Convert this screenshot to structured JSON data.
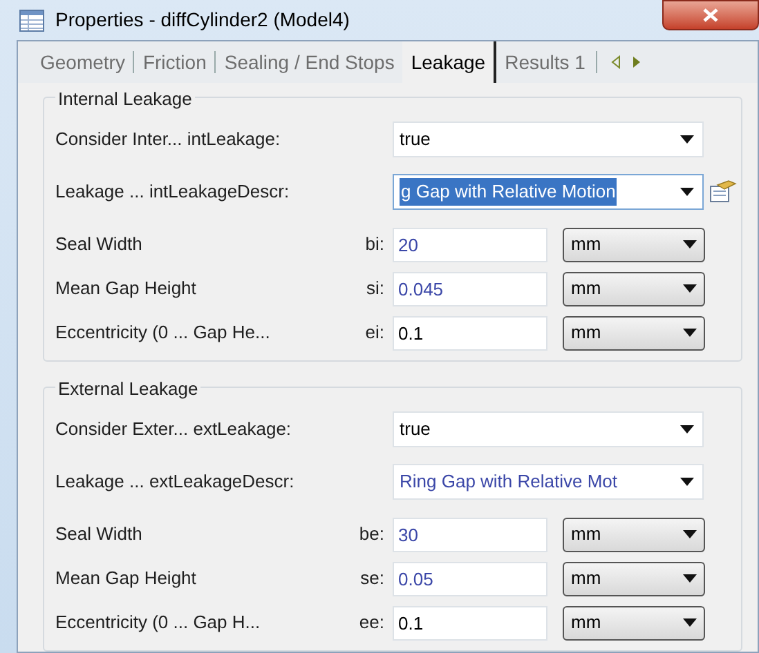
{
  "window": {
    "title": "Properties - diffCylinder2 (Model4)"
  },
  "tabs": [
    {
      "label": "Geometry",
      "selected": false
    },
    {
      "label": "Friction",
      "selected": false
    },
    {
      "label": "Sealing / End Stops",
      "selected": false
    },
    {
      "label": "Leakage",
      "selected": true
    },
    {
      "label": "Results 1",
      "selected": false
    }
  ],
  "groups": [
    {
      "title": "Internal Leakage",
      "rows": [
        {
          "kind": "dropdown",
          "label": "Consider Inter... intLeakage:",
          "value": "true",
          "modified": false,
          "text_selected": false,
          "editor_button": false
        },
        {
          "kind": "dropdown",
          "label": "Leakage ... intLeakageDescr:",
          "value": "g Gap with Relative Motion",
          "modified": false,
          "text_selected": true,
          "editor_button": true
        },
        {
          "kind": "quantity",
          "label": "Seal Width",
          "symbol": "bi:",
          "value": "20",
          "modified": true,
          "unit": "mm"
        },
        {
          "kind": "quantity",
          "label": "Mean Gap Height",
          "symbol": "si:",
          "value": "0.045",
          "modified": true,
          "unit": "mm"
        },
        {
          "kind": "quantity",
          "label": "Eccentricity (0 ... Gap He...",
          "symbol": "ei:",
          "value": "0.1",
          "modified": false,
          "unit": "mm"
        }
      ]
    },
    {
      "title": "External Leakage",
      "rows": [
        {
          "kind": "dropdown",
          "label": "Consider Exter... extLeakage:",
          "value": "true",
          "modified": false,
          "text_selected": false,
          "editor_button": false
        },
        {
          "kind": "dropdown",
          "label": "Leakage ... extLeakageDescr:",
          "value": "Ring Gap with Relative Mot",
          "modified": true,
          "text_selected": false,
          "editor_button": false
        },
        {
          "kind": "quantity",
          "label": "Seal Width",
          "symbol": "be:",
          "value": "30",
          "modified": true,
          "unit": "mm"
        },
        {
          "kind": "quantity",
          "label": "Mean Gap Height",
          "symbol": "se:",
          "value": "0.05",
          "modified": true,
          "unit": "mm"
        },
        {
          "kind": "quantity",
          "label": "Eccentricity (0 ... Gap H...",
          "symbol": "ee:",
          "value": "0.1",
          "modified": false,
          "unit": "mm"
        }
      ]
    }
  ]
}
